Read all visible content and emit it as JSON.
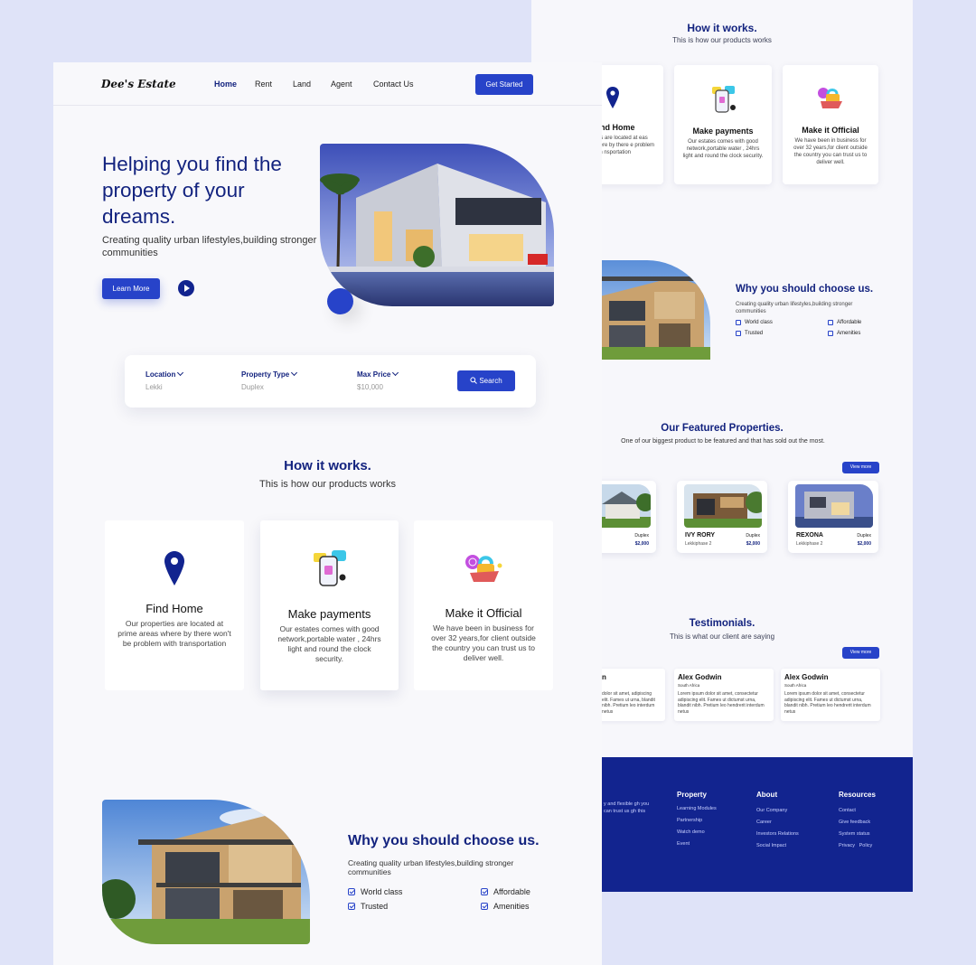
{
  "back": {
    "how": {
      "title": "How it works.",
      "subtitle": "This is how our products works"
    },
    "cards": [
      {
        "title": "nd Home",
        "desc": "rties are located at eas where by there e problem with nsportation"
      },
      {
        "title": "Make payments",
        "desc": "Our estates comes with good network,portable water , 24hrs light and round the clock security."
      },
      {
        "title": "Make it Official",
        "desc": "We have been in business for over 32 years,for client outside the country you can trust us to deliver well."
      }
    ],
    "why": {
      "title": "Why you should choose us.",
      "subtitle": "Creating quality urban lifestyles,building stronger communities",
      "features": [
        "World class",
        "Affordable",
        "Trusted",
        "Amenities"
      ]
    },
    "featured": {
      "title": "Our Featured Properties.",
      "subtitle": "One of our biggest product to be featured and that has sold out the most.",
      "view_more": "View more",
      "properties": [
        {
          "name": "ce",
          "location": "",
          "type": "Duplex",
          "price": "$2,000"
        },
        {
          "name": "IVY RORY",
          "location": "Lekkiphase 2",
          "type": "Duplex",
          "price": "$2,000"
        },
        {
          "name": "REXONA",
          "location": "Lekkiphase 2",
          "type": "Duplex",
          "price": "$2,000"
        }
      ]
    },
    "testimonials": {
      "title": "Testimonials.",
      "subtitle": "This is what our client are saying",
      "view_more": "View more",
      "items": [
        {
          "name": "n",
          "country": "",
          "quote": "dolor sit amet, adipiscing elit. Fames ut urna, blandit nibh. Pretium leo interdum netus"
        },
        {
          "name": "Alex Godwin",
          "country": "South Africa",
          "quote": "Lorem ipsum dolor sit amet, consectetur adipiscing elit. Fames ut dictumst urna, blandit nibh. Pretium leo hendrerit interdum netus"
        },
        {
          "name": "Alex Godwin",
          "country": "South Africa",
          "quote": "Lorem ipsum dolor sit amet, consectetur adipiscing elit. Fames ut dictumst urna, blandit nibh. Pretium leo hendrerit interdum netus"
        }
      ]
    },
    "footer": {
      "intro": "y and flexible gh you can trust us gh this",
      "columns": [
        {
          "heading": "Property",
          "links": [
            "Learning Modules",
            "Partnership",
            "Watch demo",
            "Event"
          ]
        },
        {
          "heading": "About",
          "links": [
            "Our Company",
            "Career",
            "Investors Relations",
            "Social Impact"
          ]
        },
        {
          "heading": "Resources",
          "links": [
            "Contact",
            "Give feedback",
            "System status",
            "Privacy   Policy"
          ]
        }
      ]
    }
  },
  "front": {
    "logo": "Dee's Estate",
    "nav": [
      "Home",
      "Rent",
      "Land",
      "Agent",
      "Contact Us"
    ],
    "get_started": "Get Started",
    "hero": {
      "title": "Helping you find the property of your dreams.",
      "subtitle": "Creating quality urban lifestyles,building stronger communities",
      "learn_more": "Learn More"
    },
    "search": {
      "location_label": "Location",
      "location_value": "Lekki",
      "type_label": "Property Type",
      "type_value": "Duplex",
      "price_label": "Max Price",
      "price_value": "$10,000",
      "button": "Search"
    },
    "how": {
      "title": "How it works.",
      "subtitle": "This is how our products works"
    },
    "cards": [
      {
        "title": "Find Home",
        "desc": "Our properties are located at prime areas where by there won't be problem with transportation"
      },
      {
        "title": "Make payments",
        "desc": "Our estates comes with good network,portable water , 24hrs light and round the clock security."
      },
      {
        "title": "Make it Official",
        "desc": "We have been in business for over 32 years,for client outside the country you can trust  us to deliver well."
      }
    ],
    "why": {
      "title": "Why you should choose us.",
      "subtitle": "Creating quality urban lifestyles,building stronger communities",
      "features": [
        "World class",
        "Affordable",
        "Trusted",
        "Amenities"
      ]
    }
  },
  "colors": {
    "brand": "#2743c9",
    "navy": "#13237f",
    "footer": "#12248f",
    "page_bg": "#dfe3f8"
  }
}
